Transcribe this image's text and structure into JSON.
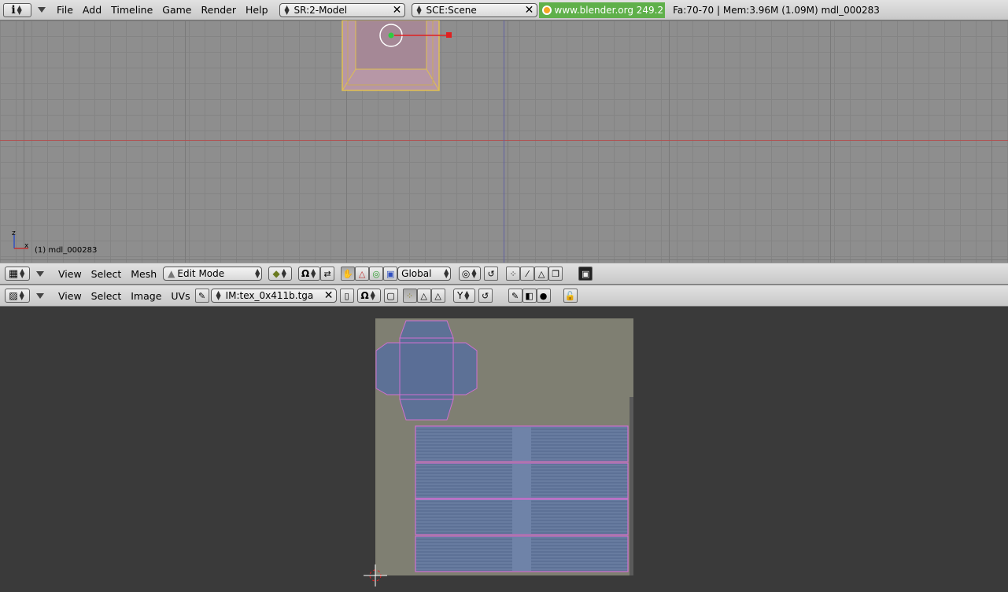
{
  "top_header": {
    "menus": [
      "File",
      "Add",
      "Timeline",
      "Game",
      "Render",
      "Help"
    ],
    "screen": "SR:2-Model",
    "scene": "SCE:Scene",
    "version": "www.blender.org 249.2",
    "stats": "Fa:70-70 | Mem:3.96M (1.09M) mdl_000283"
  },
  "viewport3d": {
    "object_label": "(1) mdl_000283",
    "axis_x": "x",
    "axis_z": "z"
  },
  "view3d_header": {
    "menus": [
      "View",
      "Select",
      "Mesh"
    ],
    "mode": "Edit Mode",
    "orientation": "Global"
  },
  "uv_header": {
    "menus": [
      "View",
      "Select",
      "Image",
      "UVs"
    ],
    "image_name": "IM:tex_0x411b.tga"
  },
  "colors": {
    "accent_green": "#5fb04a",
    "selection_pink": "#d070d0",
    "uv_blue": "#5a6e96"
  },
  "icons": {
    "info": "info-icon",
    "grid": "grid-view-icon",
    "image_editor": "image-editor-icon",
    "blender": "blender-logo-icon",
    "close": "close-icon"
  }
}
